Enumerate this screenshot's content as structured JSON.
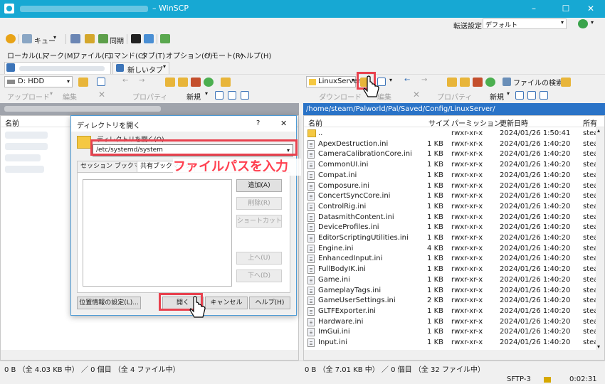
{
  "window": {
    "title": "– WinSCP",
    "minimize": "–",
    "maximize": "☐",
    "close": "✕"
  },
  "toolbar": {
    "queue_label": "キュー",
    "sync_label": "同期",
    "transfer_settings_label": "転送設定",
    "transfer_settings_value": "デフォルト"
  },
  "menu": [
    "ローカル(L)",
    "マーク(M)",
    "ファイル(F)",
    "コマンド(C)",
    "タブ(T)",
    "オプション(O)",
    "リモート(R)",
    "ヘルプ(H)"
  ],
  "tabs": {
    "new_tab_label": "新しいタブ"
  },
  "local": {
    "drive_label": "D: HDD",
    "upload_label": "アップロード",
    "edit_label": "編集",
    "properties_label": "プロパティ",
    "new_label": "新規",
    "columns": {
      "name": "名前"
    },
    "status": "0 B （全 4.03 KB 中） ／ 0 個目 （全 4 ファイル中）"
  },
  "remote": {
    "site_label": "LinuxServer",
    "find_files_label": "ファイルの検索",
    "download_label": "ダウンロード",
    "edit_label": "編集",
    "properties_label": "プロパティ",
    "new_label": "新規",
    "path": "/home/steam/Palworld/Pal/Saved/Config/LinuxServer/",
    "columns": {
      "name": "名前",
      "size": "サイズ",
      "permission": "パーミッション",
      "modified": "更新日時",
      "owner": "所有"
    },
    "files": [
      {
        "name": "..",
        "size": "",
        "perm": "rwxr-xr-x",
        "date": "2024/01/26 1:50:41",
        "owner": "stea"
      },
      {
        "name": "ApexDestruction.ini",
        "size": "1 KB",
        "perm": "rwxr-xr-x",
        "date": "2024/01/26 1:40:20",
        "owner": "stea"
      },
      {
        "name": "CameraCalibrationCore.ini",
        "size": "1 KB",
        "perm": "rwxr-xr-x",
        "date": "2024/01/26 1:40:20",
        "owner": "stea"
      },
      {
        "name": "CommonUI.ini",
        "size": "1 KB",
        "perm": "rwxr-xr-x",
        "date": "2024/01/26 1:40:20",
        "owner": "stea"
      },
      {
        "name": "Compat.ini",
        "size": "1 KB",
        "perm": "rwxr-xr-x",
        "date": "2024/01/26 1:40:20",
        "owner": "stea"
      },
      {
        "name": "Composure.ini",
        "size": "1 KB",
        "perm": "rwxr-xr-x",
        "date": "2024/01/26 1:40:20",
        "owner": "stea"
      },
      {
        "name": "ConcertSyncCore.ini",
        "size": "1 KB",
        "perm": "rwxr-xr-x",
        "date": "2024/01/26 1:40:20",
        "owner": "stea"
      },
      {
        "name": "ControlRig.ini",
        "size": "1 KB",
        "perm": "rwxr-xr-x",
        "date": "2024/01/26 1:40:20",
        "owner": "stea"
      },
      {
        "name": "DatasmithContent.ini",
        "size": "1 KB",
        "perm": "rwxr-xr-x",
        "date": "2024/01/26 1:40:20",
        "owner": "stea"
      },
      {
        "name": "DeviceProfiles.ini",
        "size": "1 KB",
        "perm": "rwxr-xr-x",
        "date": "2024/01/26 1:40:20",
        "owner": "stea"
      },
      {
        "name": "EditorScriptingUtilities.ini",
        "size": "1 KB",
        "perm": "rwxr-xr-x",
        "date": "2024/01/26 1:40:20",
        "owner": "stea"
      },
      {
        "name": "Engine.ini",
        "size": "4 KB",
        "perm": "rwxr-xr-x",
        "date": "2024/01/26 1:40:20",
        "owner": "stea"
      },
      {
        "name": "EnhancedInput.ini",
        "size": "1 KB",
        "perm": "rwxr-xr-x",
        "date": "2024/01/26 1:40:20",
        "owner": "stea"
      },
      {
        "name": "FullBodyIK.ini",
        "size": "1 KB",
        "perm": "rwxr-xr-x",
        "date": "2024/01/26 1:40:20",
        "owner": "stea"
      },
      {
        "name": "Game.ini",
        "size": "1 KB",
        "perm": "rwxr-xr-x",
        "date": "2024/01/26 1:40:20",
        "owner": "stea"
      },
      {
        "name": "GameplayTags.ini",
        "size": "1 KB",
        "perm": "rwxr-xr-x",
        "date": "2024/01/26 1:40:20",
        "owner": "stea"
      },
      {
        "name": "GameUserSettings.ini",
        "size": "2 KB",
        "perm": "rwxr-xr-x",
        "date": "2024/01/26 1:40:20",
        "owner": "stea"
      },
      {
        "name": "GLTFExporter.ini",
        "size": "1 KB",
        "perm": "rwxr-xr-x",
        "date": "2024/01/26 1:40:20",
        "owner": "stea"
      },
      {
        "name": "Hardware.ini",
        "size": "1 KB",
        "perm": "rwxr-xr-x",
        "date": "2024/01/26 1:40:20",
        "owner": "stea"
      },
      {
        "name": "ImGui.ini",
        "size": "1 KB",
        "perm": "rwxr-xr-x",
        "date": "2024/01/26 1:40:20",
        "owner": "stea"
      },
      {
        "name": "Input.ini",
        "size": "1 KB",
        "perm": "rwxr-xr-x",
        "date": "2024/01/26 1:40:20",
        "owner": "stea"
      }
    ],
    "status": "0 B （全 7.01 KB 中） ／ 0 個目 （全 32 ファイル中）"
  },
  "dialog": {
    "title": "ディレクトリを開く",
    "help_mark": "?",
    "close": "✕",
    "field_label": "ディレクトリを開く(O)",
    "path_value": "/etc/systemd/system",
    "tab_session": "セッション ブックマーク",
    "tab_shared": "共有ブックマーク",
    "btn_add": "追加(A)",
    "btn_delete": "削除(R)",
    "btn_shortcut": "ショートカット(S)...",
    "btn_up": "上へ(U)",
    "btn_down": "下へ(D)",
    "btn_location": "位置情報の設定(L)...",
    "btn_open": "開く",
    "btn_cancel": "キャンセル",
    "btn_help": "ヘルプ(H)"
  },
  "annotation": {
    "text": "ファイルパスを入力"
  },
  "status": {
    "protocol": "SFTP-3",
    "elapsed": "0:02:31"
  },
  "colors": {
    "titlebar": "#17a8d3",
    "path_active": "#2a73c7",
    "highlight": "#e8414e"
  }
}
